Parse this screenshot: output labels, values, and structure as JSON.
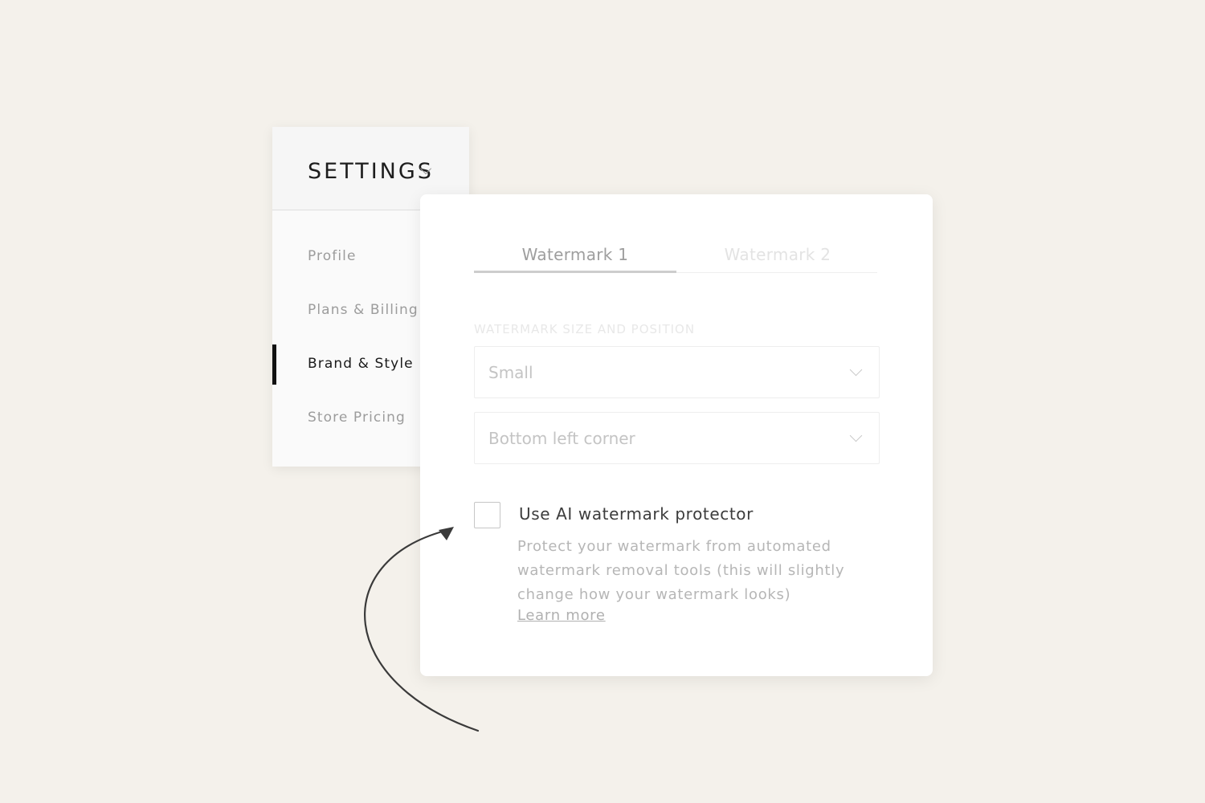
{
  "sidebar": {
    "title": "SETTINGS",
    "title_icon": "chevron-down-icon",
    "items": [
      {
        "label": "Profile",
        "active": false
      },
      {
        "label": "Plans & Billing",
        "active": false
      },
      {
        "label": "Brand & Style",
        "active": true
      },
      {
        "label": "Store Pricing",
        "active": false
      }
    ]
  },
  "panel": {
    "tabs": [
      {
        "label": "Watermark 1",
        "active": true
      },
      {
        "label": "Watermark 2",
        "active": false
      }
    ],
    "section_label": "WATERMARK SIZE AND POSITION",
    "size_select": {
      "value": "Small",
      "icon": "chevron-down-icon"
    },
    "position_select": {
      "value": "Bottom left corner",
      "icon": "chevron-down-icon"
    },
    "ai_protector": {
      "checked": false,
      "label": "Use AI watermark protector",
      "description": "Protect your watermark from automated watermark removal tools (this will slightly change how your watermark looks)",
      "link": "Learn more"
    }
  },
  "annotation": {
    "icon": "curved-arrow-icon"
  },
  "colors": {
    "background": "#f4f1eb",
    "card": "#ffffff",
    "active_indicator": "#111111",
    "arrow": "#3a3a3a"
  }
}
